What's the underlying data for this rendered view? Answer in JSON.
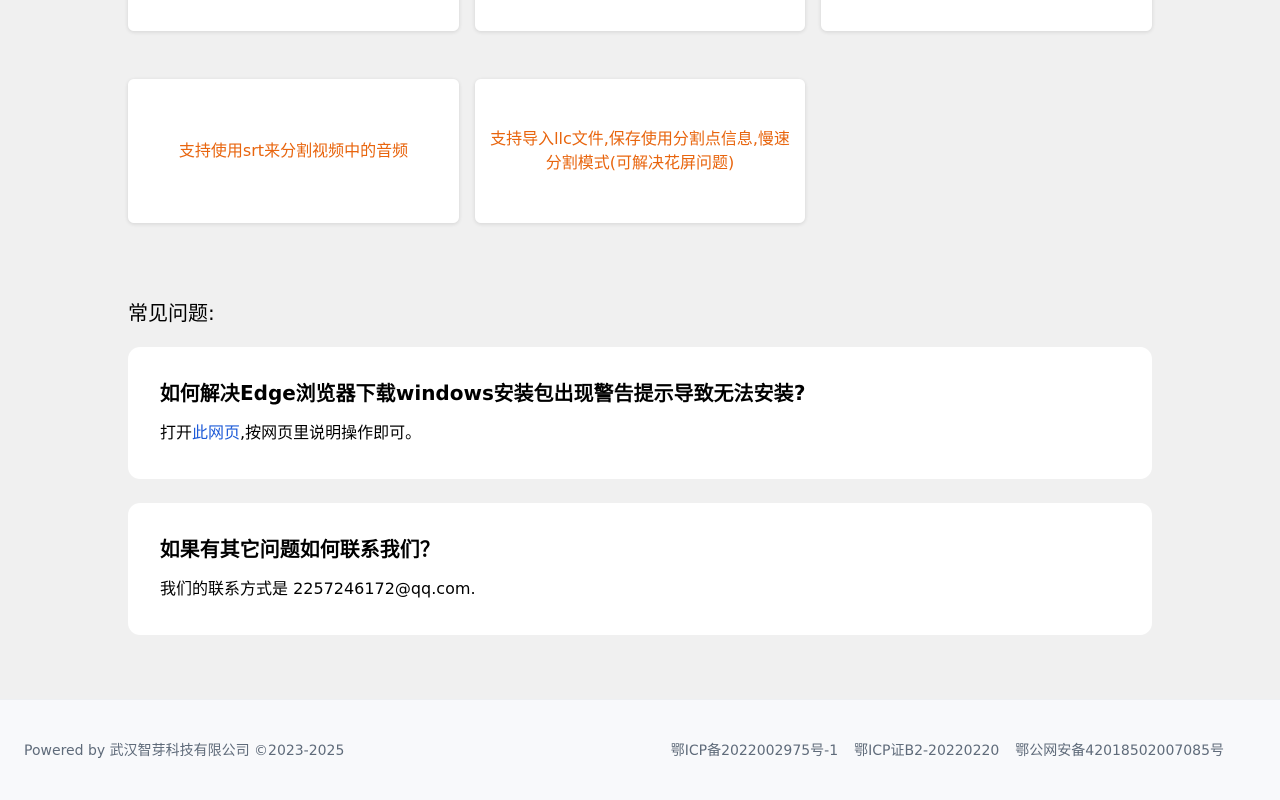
{
  "features": {
    "top_row_cards": [
      "",
      "",
      ""
    ],
    "row": [
      {
        "text": "支持使用srt来分割视频中的音频"
      },
      {
        "text": "支持导入llc文件,保存使用分割点信息,慢速分割模式(可解决花屏问题)"
      }
    ]
  },
  "faq": {
    "section_title": "常见问题:",
    "items": [
      {
        "question": "如何解决Edge浏览器下载windows安装包出现警告提示导致无法安装?",
        "answer_prefix": "打开",
        "answer_link": "此网页",
        "answer_suffix": ",按网页里说明操作即可。"
      },
      {
        "question": "如果有其它问题如何联系我们？",
        "answer": "我们的联系方式是 2257246172@qq.com."
      }
    ]
  },
  "footer": {
    "powered_by": "Powered by 武汉智芽科技有限公司 ©2023-2025",
    "icp1": "鄂ICP备2022002975号-1",
    "icp2": "鄂ICP证B2-20220220",
    "police": "鄂公网安备42018502007085号"
  },
  "colors": {
    "accent_orange": "#e8650e",
    "link_blue": "#1e5bd8",
    "background": "#f0f0f0"
  }
}
